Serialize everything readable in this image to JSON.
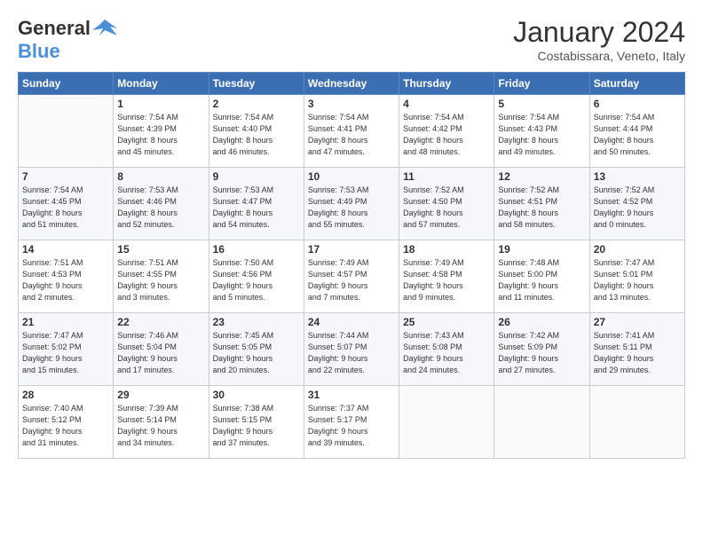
{
  "header": {
    "logo_line1": "General",
    "logo_line2": "Blue",
    "month_title": "January 2024",
    "subtitle": "Costabissara, Veneto, Italy"
  },
  "days_of_week": [
    "Sunday",
    "Monday",
    "Tuesday",
    "Wednesday",
    "Thursday",
    "Friday",
    "Saturday"
  ],
  "weeks": [
    [
      {
        "day": "",
        "info": ""
      },
      {
        "day": "1",
        "info": "Sunrise: 7:54 AM\nSunset: 4:39 PM\nDaylight: 8 hours\nand 45 minutes."
      },
      {
        "day": "2",
        "info": "Sunrise: 7:54 AM\nSunset: 4:40 PM\nDaylight: 8 hours\nand 46 minutes."
      },
      {
        "day": "3",
        "info": "Sunrise: 7:54 AM\nSunset: 4:41 PM\nDaylight: 8 hours\nand 47 minutes."
      },
      {
        "day": "4",
        "info": "Sunrise: 7:54 AM\nSunset: 4:42 PM\nDaylight: 8 hours\nand 48 minutes."
      },
      {
        "day": "5",
        "info": "Sunrise: 7:54 AM\nSunset: 4:43 PM\nDaylight: 8 hours\nand 49 minutes."
      },
      {
        "day": "6",
        "info": "Sunrise: 7:54 AM\nSunset: 4:44 PM\nDaylight: 8 hours\nand 50 minutes."
      }
    ],
    [
      {
        "day": "7",
        "info": "Sunrise: 7:54 AM\nSunset: 4:45 PM\nDaylight: 8 hours\nand 51 minutes."
      },
      {
        "day": "8",
        "info": "Sunrise: 7:53 AM\nSunset: 4:46 PM\nDaylight: 8 hours\nand 52 minutes."
      },
      {
        "day": "9",
        "info": "Sunrise: 7:53 AM\nSunset: 4:47 PM\nDaylight: 8 hours\nand 54 minutes."
      },
      {
        "day": "10",
        "info": "Sunrise: 7:53 AM\nSunset: 4:49 PM\nDaylight: 8 hours\nand 55 minutes."
      },
      {
        "day": "11",
        "info": "Sunrise: 7:52 AM\nSunset: 4:50 PM\nDaylight: 8 hours\nand 57 minutes."
      },
      {
        "day": "12",
        "info": "Sunrise: 7:52 AM\nSunset: 4:51 PM\nDaylight: 8 hours\nand 58 minutes."
      },
      {
        "day": "13",
        "info": "Sunrise: 7:52 AM\nSunset: 4:52 PM\nDaylight: 9 hours\nand 0 minutes."
      }
    ],
    [
      {
        "day": "14",
        "info": "Sunrise: 7:51 AM\nSunset: 4:53 PM\nDaylight: 9 hours\nand 2 minutes."
      },
      {
        "day": "15",
        "info": "Sunrise: 7:51 AM\nSunset: 4:55 PM\nDaylight: 9 hours\nand 3 minutes."
      },
      {
        "day": "16",
        "info": "Sunrise: 7:50 AM\nSunset: 4:56 PM\nDaylight: 9 hours\nand 5 minutes."
      },
      {
        "day": "17",
        "info": "Sunrise: 7:49 AM\nSunset: 4:57 PM\nDaylight: 9 hours\nand 7 minutes."
      },
      {
        "day": "18",
        "info": "Sunrise: 7:49 AM\nSunset: 4:58 PM\nDaylight: 9 hours\nand 9 minutes."
      },
      {
        "day": "19",
        "info": "Sunrise: 7:48 AM\nSunset: 5:00 PM\nDaylight: 9 hours\nand 11 minutes."
      },
      {
        "day": "20",
        "info": "Sunrise: 7:47 AM\nSunset: 5:01 PM\nDaylight: 9 hours\nand 13 minutes."
      }
    ],
    [
      {
        "day": "21",
        "info": "Sunrise: 7:47 AM\nSunset: 5:02 PM\nDaylight: 9 hours\nand 15 minutes."
      },
      {
        "day": "22",
        "info": "Sunrise: 7:46 AM\nSunset: 5:04 PM\nDaylight: 9 hours\nand 17 minutes."
      },
      {
        "day": "23",
        "info": "Sunrise: 7:45 AM\nSunset: 5:05 PM\nDaylight: 9 hours\nand 20 minutes."
      },
      {
        "day": "24",
        "info": "Sunrise: 7:44 AM\nSunset: 5:07 PM\nDaylight: 9 hours\nand 22 minutes."
      },
      {
        "day": "25",
        "info": "Sunrise: 7:43 AM\nSunset: 5:08 PM\nDaylight: 9 hours\nand 24 minutes."
      },
      {
        "day": "26",
        "info": "Sunrise: 7:42 AM\nSunset: 5:09 PM\nDaylight: 9 hours\nand 27 minutes."
      },
      {
        "day": "27",
        "info": "Sunrise: 7:41 AM\nSunset: 5:11 PM\nDaylight: 9 hours\nand 29 minutes."
      }
    ],
    [
      {
        "day": "28",
        "info": "Sunrise: 7:40 AM\nSunset: 5:12 PM\nDaylight: 9 hours\nand 31 minutes."
      },
      {
        "day": "29",
        "info": "Sunrise: 7:39 AM\nSunset: 5:14 PM\nDaylight: 9 hours\nand 34 minutes."
      },
      {
        "day": "30",
        "info": "Sunrise: 7:38 AM\nSunset: 5:15 PM\nDaylight: 9 hours\nand 37 minutes."
      },
      {
        "day": "31",
        "info": "Sunrise: 7:37 AM\nSunset: 5:17 PM\nDaylight: 9 hours\nand 39 minutes."
      },
      {
        "day": "",
        "info": ""
      },
      {
        "day": "",
        "info": ""
      },
      {
        "day": "",
        "info": ""
      }
    ]
  ]
}
